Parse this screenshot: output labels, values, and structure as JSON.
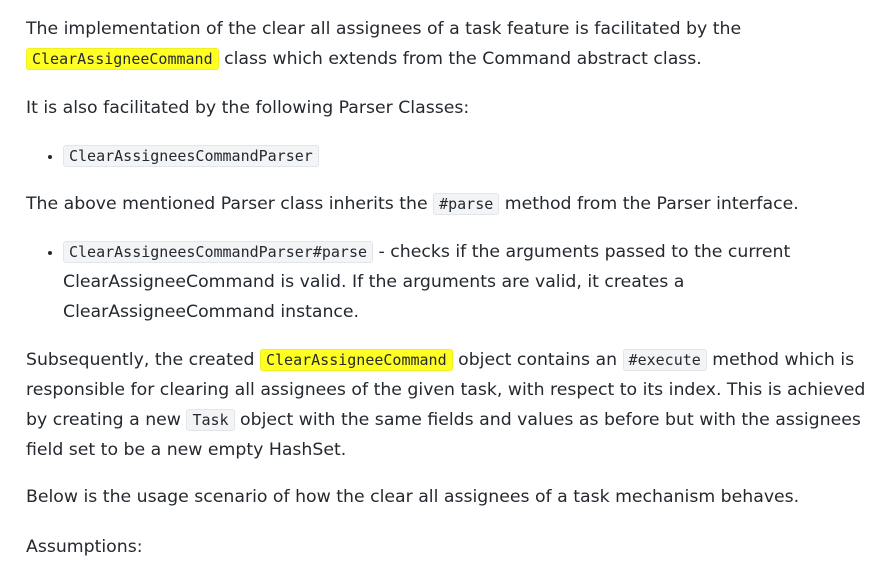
{
  "para1": {
    "text_a": "The implementation of the clear all assignees of a task feature is facilitated by the ",
    "code": "ClearAssigneeCommand",
    "text_b": " class which extends from the Command abstract class."
  },
  "para2": {
    "text": "It is also facilitated by the following Parser Classes:"
  },
  "list1": {
    "item1_code": "ClearAssigneesCommandParser"
  },
  "para3": {
    "text_a": "The above mentioned Parser class inherits the ",
    "code": "#parse",
    "text_b": " method from the Parser interface."
  },
  "list2": {
    "item1_code": "ClearAssigneesCommandParser#parse",
    "item1_text": " - checks if the arguments passed to the current ClearAssigneeCommand is valid. If the arguments are valid, it creates a ClearAssigneeCommand instance."
  },
  "para4": {
    "text_a": "Subsequently, the created ",
    "code1": "ClearAssigneeCommand",
    "text_b": " object contains an ",
    "code2": "#execute",
    "text_c": " method which is responsible for clearing all assignees of the given task, with respect to its index. This is achieved by creating a new ",
    "code3": "Task",
    "text_d": " object with the same fields and values as before but with the assignees field set to be a new empty HashSet."
  },
  "para5": {
    "text": "Below is the usage scenario of how the clear all assignees of a task mechanism behaves."
  },
  "para6": {
    "text": "Assumptions:"
  }
}
